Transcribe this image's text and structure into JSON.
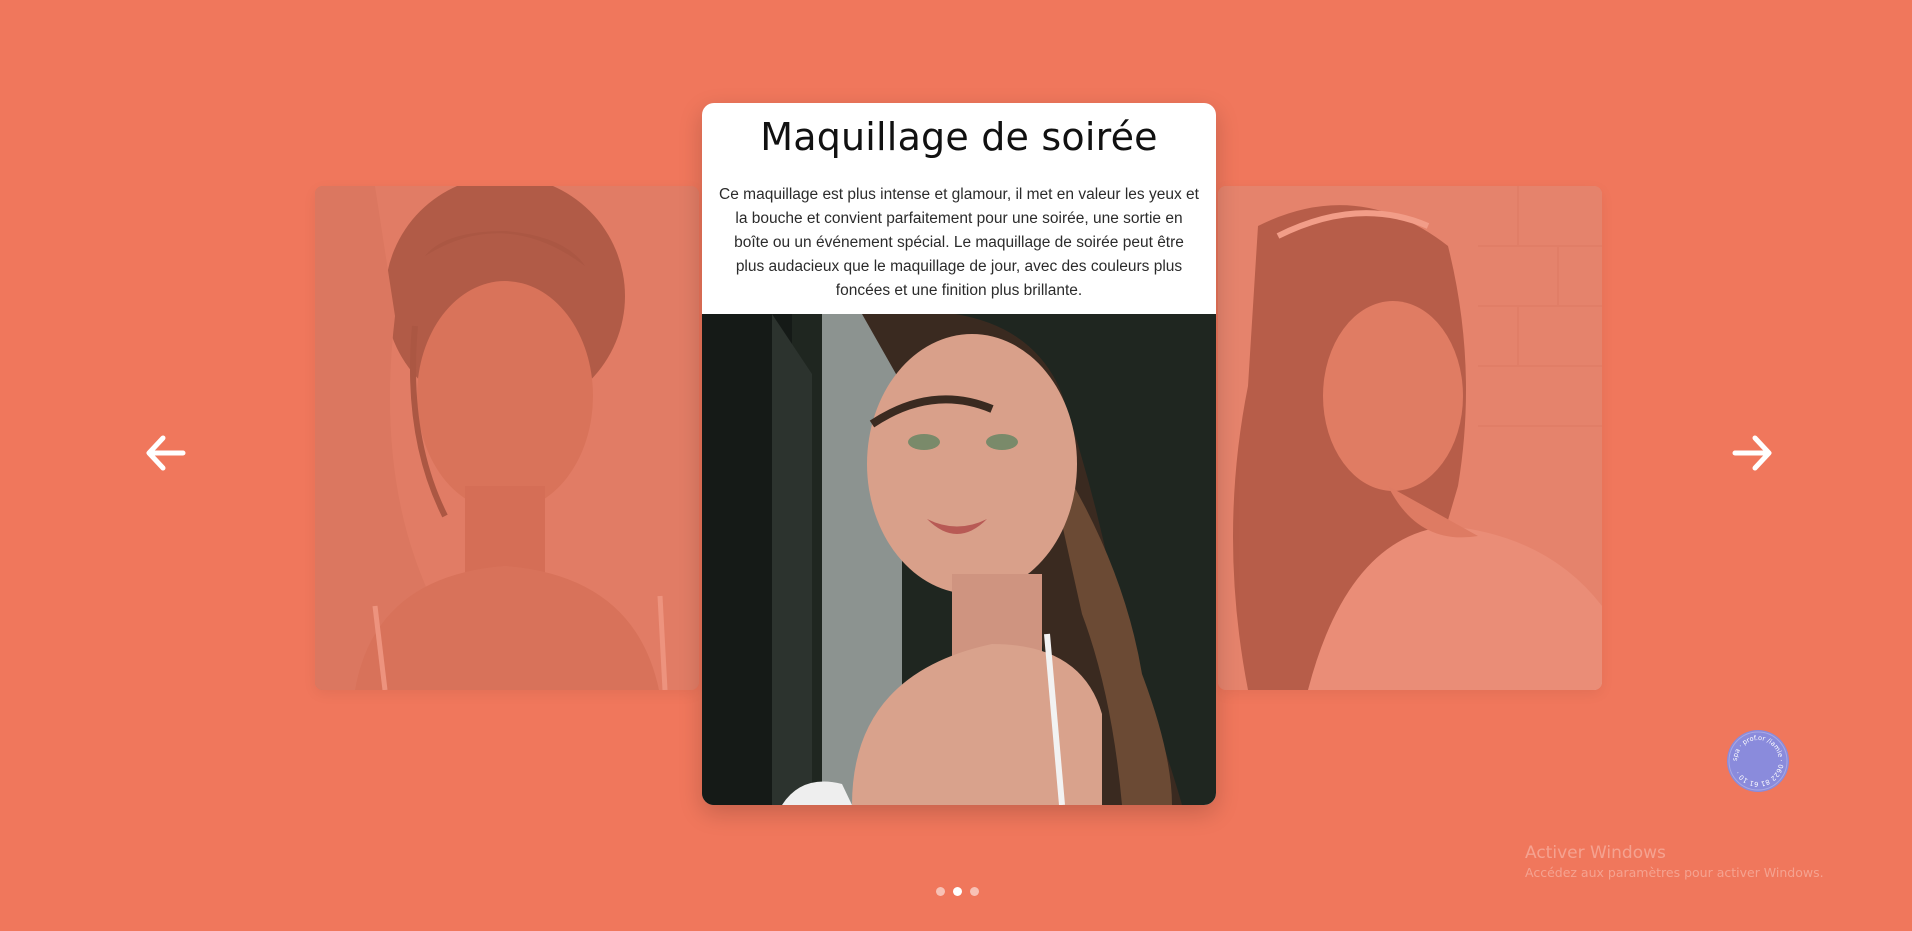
{
  "carousel": {
    "active": {
      "title": "Maquillage de soirée",
      "description": "Ce maquillage est plus intense et glamour, il met en valeur les yeux et la bouche et convient parfaitement pour une soirée, une sortie en boîte ou un événement spécial. Le maquillage de soirée peut être plus audacieux que le maquillage de jour, avec des couleurs plus foncées et une finition plus brillante."
    },
    "dots_count": 3,
    "active_dot_index": 1
  },
  "navigation": {
    "prev_icon": "arrow-left-icon",
    "next_icon": "arrow-right-icon"
  },
  "badge": {
    "text": "spa · prof.or /iamie · 0622 81 61 10 ·"
  },
  "watermark": {
    "title": "Activer Windows",
    "subtitle": "Accédez aux paramètres pour activer Windows."
  },
  "colors": {
    "background": "#f0775c",
    "card": "#ffffff",
    "badge": "#8a8bdc"
  }
}
